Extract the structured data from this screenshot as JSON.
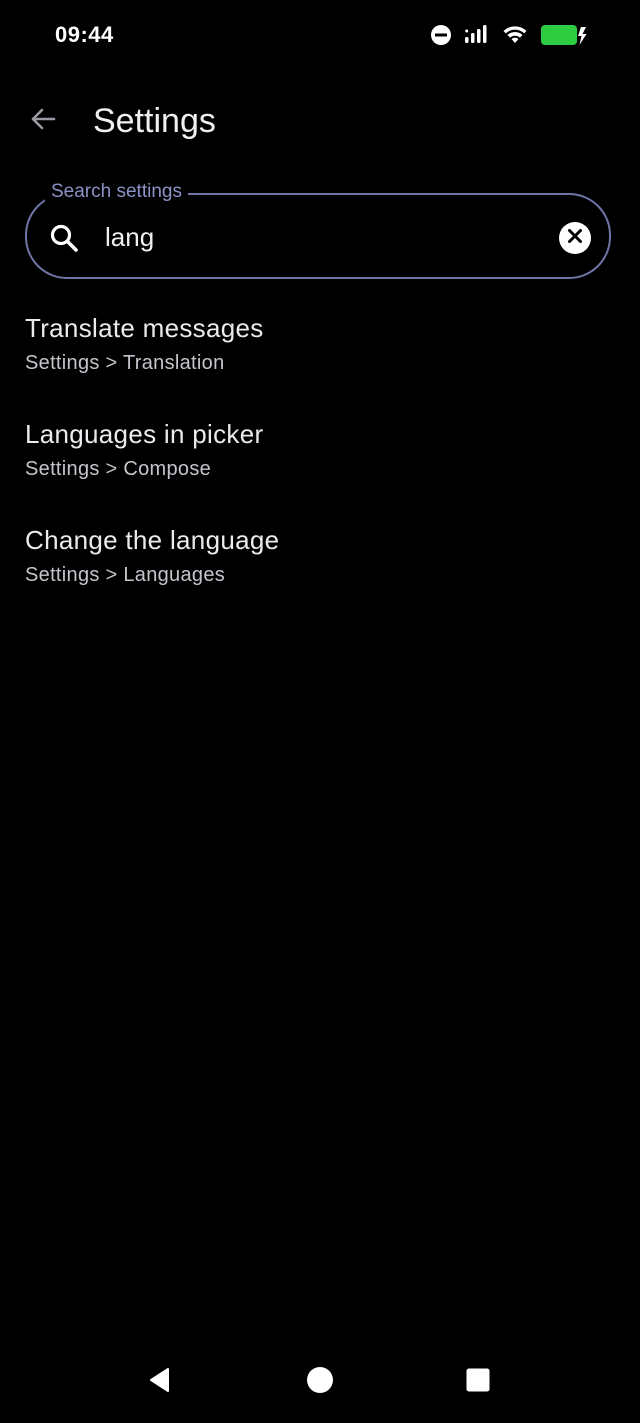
{
  "status_bar": {
    "time": "09:44",
    "icons": [
      "do-not-disturb-icon",
      "signal-icon",
      "wifi-icon",
      "battery-charging-icon"
    ],
    "battery_color": "#2ecc40"
  },
  "app_bar": {
    "back_icon": "arrow-left-icon",
    "title": "Settings"
  },
  "search": {
    "label": "Search settings",
    "value": "lang",
    "border_color": "#6f75a6",
    "label_color": "#8b93c7"
  },
  "results": [
    {
      "title": "Translate messages",
      "path": "Settings > Translation"
    },
    {
      "title": "Languages in picker",
      "path": "Settings > Compose"
    },
    {
      "title": "Change the language",
      "path": "Settings > Languages"
    }
  ],
  "nav_bar": {
    "icons": [
      "back-triangle-icon",
      "home-circle-icon",
      "recents-square-icon"
    ]
  }
}
